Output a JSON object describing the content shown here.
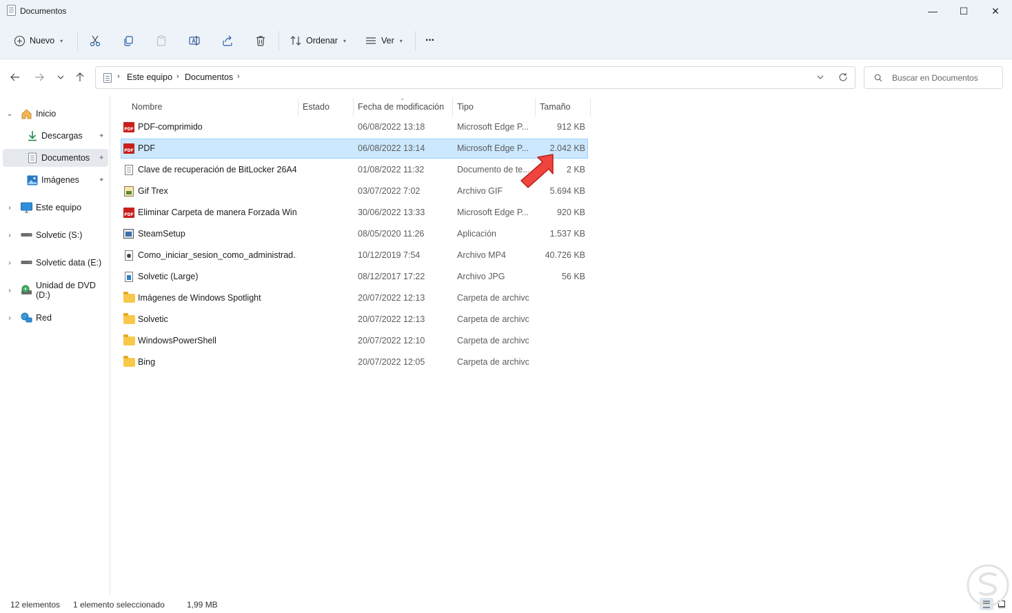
{
  "window": {
    "title": "Documentos",
    "minimize_glyph": "—",
    "maximize_glyph": "☐",
    "close_glyph": "✕"
  },
  "commandbar": {
    "new_label": "Nuevo",
    "sort_label": "Ordenar",
    "view_label": "Ver",
    "more_glyph": "···",
    "icons": [
      "cut-icon",
      "copy-icon",
      "paste-icon",
      "rename-icon",
      "share-icon",
      "delete-icon"
    ]
  },
  "address": {
    "crumbs": [
      "Este equipo",
      "Documentos"
    ],
    "separator": "›"
  },
  "search": {
    "placeholder": "Buscar en Documentos"
  },
  "sidebar": {
    "items": [
      {
        "label": "Inicio",
        "icon": "home-icon",
        "expand": "⌄",
        "pinned": false
      },
      {
        "label": "Descargas",
        "icon": "download-icon",
        "pinned": true
      },
      {
        "label": "Documentos",
        "icon": "documents-icon",
        "pinned": true,
        "selected": true
      },
      {
        "label": "Imágenes",
        "icon": "pictures-icon",
        "pinned": true
      },
      {
        "label": "Este equipo",
        "icon": "computer-icon",
        "expand": "›"
      },
      {
        "label": "Solvetic (S:)",
        "icon": "drive-icon",
        "expand": "›"
      },
      {
        "label": "Solvetic data (E:)",
        "icon": "drive-icon",
        "expand": "›"
      },
      {
        "label": "Unidad de DVD (D:)",
        "icon": "dvd-icon",
        "expand": "›"
      },
      {
        "label": "Red",
        "icon": "network-icon",
        "expand": "›"
      }
    ],
    "pin_glyph": "📌"
  },
  "table": {
    "columns": [
      "Nombre",
      "Estado",
      "Fecha de modificación",
      "Tipo",
      "Tamaño"
    ],
    "sort_glyph": "⌄",
    "rows": [
      {
        "name": "PDF-comprimido",
        "date": "06/08/2022 13:18",
        "type": "Microsoft Edge P...",
        "size": "912 KB",
        "icon": "pdf"
      },
      {
        "name": "PDF",
        "date": "06/08/2022 13:14",
        "type": "Microsoft Edge P...",
        "size": "2.042 KB",
        "icon": "pdf",
        "selected": true
      },
      {
        "name": "Clave de recuperación de BitLocker 26A4...",
        "date": "01/08/2022 11:32",
        "type": "Documento de te...",
        "size": "2 KB",
        "icon": "txt"
      },
      {
        "name": "Gif Trex",
        "date": "03/07/2022 7:02",
        "type": "Archivo GIF",
        "size": "5.694 KB",
        "icon": "gif"
      },
      {
        "name": "Eliminar Carpeta de manera Forzada Win...",
        "date": "30/06/2022 13:33",
        "type": "Microsoft Edge P...",
        "size": "920 KB",
        "icon": "pdf"
      },
      {
        "name": "SteamSetup",
        "date": "08/05/2020 11:26",
        "type": "Aplicación",
        "size": "1.537 KB",
        "icon": "app"
      },
      {
        "name": "Como_iniciar_sesion_como_administrad...",
        "date": "10/12/2019 7:54",
        "type": "Archivo MP4",
        "size": "40.726 KB",
        "icon": "mp4"
      },
      {
        "name": "Solvetic (Large)",
        "date": "08/12/2017 17:22",
        "type": "Archivo JPG",
        "size": "56 KB",
        "icon": "jpg"
      },
      {
        "name": "Imágenes de Windows Spotlight",
        "date": "20/07/2022 12:13",
        "type": "Carpeta de archivos",
        "size": "",
        "icon": "folder"
      },
      {
        "name": "Solvetic",
        "date": "20/07/2022 12:13",
        "type": "Carpeta de archivos",
        "size": "",
        "icon": "folder"
      },
      {
        "name": "WindowsPowerShell",
        "date": "20/07/2022 12:10",
        "type": "Carpeta de archivos",
        "size": "",
        "icon": "folder"
      },
      {
        "name": "Bing",
        "date": "20/07/2022 12:05",
        "type": "Carpeta de archivos",
        "size": "",
        "icon": "folder"
      }
    ]
  },
  "status": {
    "count": "12 elementos",
    "selection": "1 elemento seleccionado",
    "selection_size": "1,99 MB"
  },
  "colors": {
    "accent_selected_bg": "#cce8ff",
    "accent_selected_border": "#99d1ff",
    "annotation_arrow": "#f0443e",
    "chrome_bg": "#eef3f9"
  }
}
